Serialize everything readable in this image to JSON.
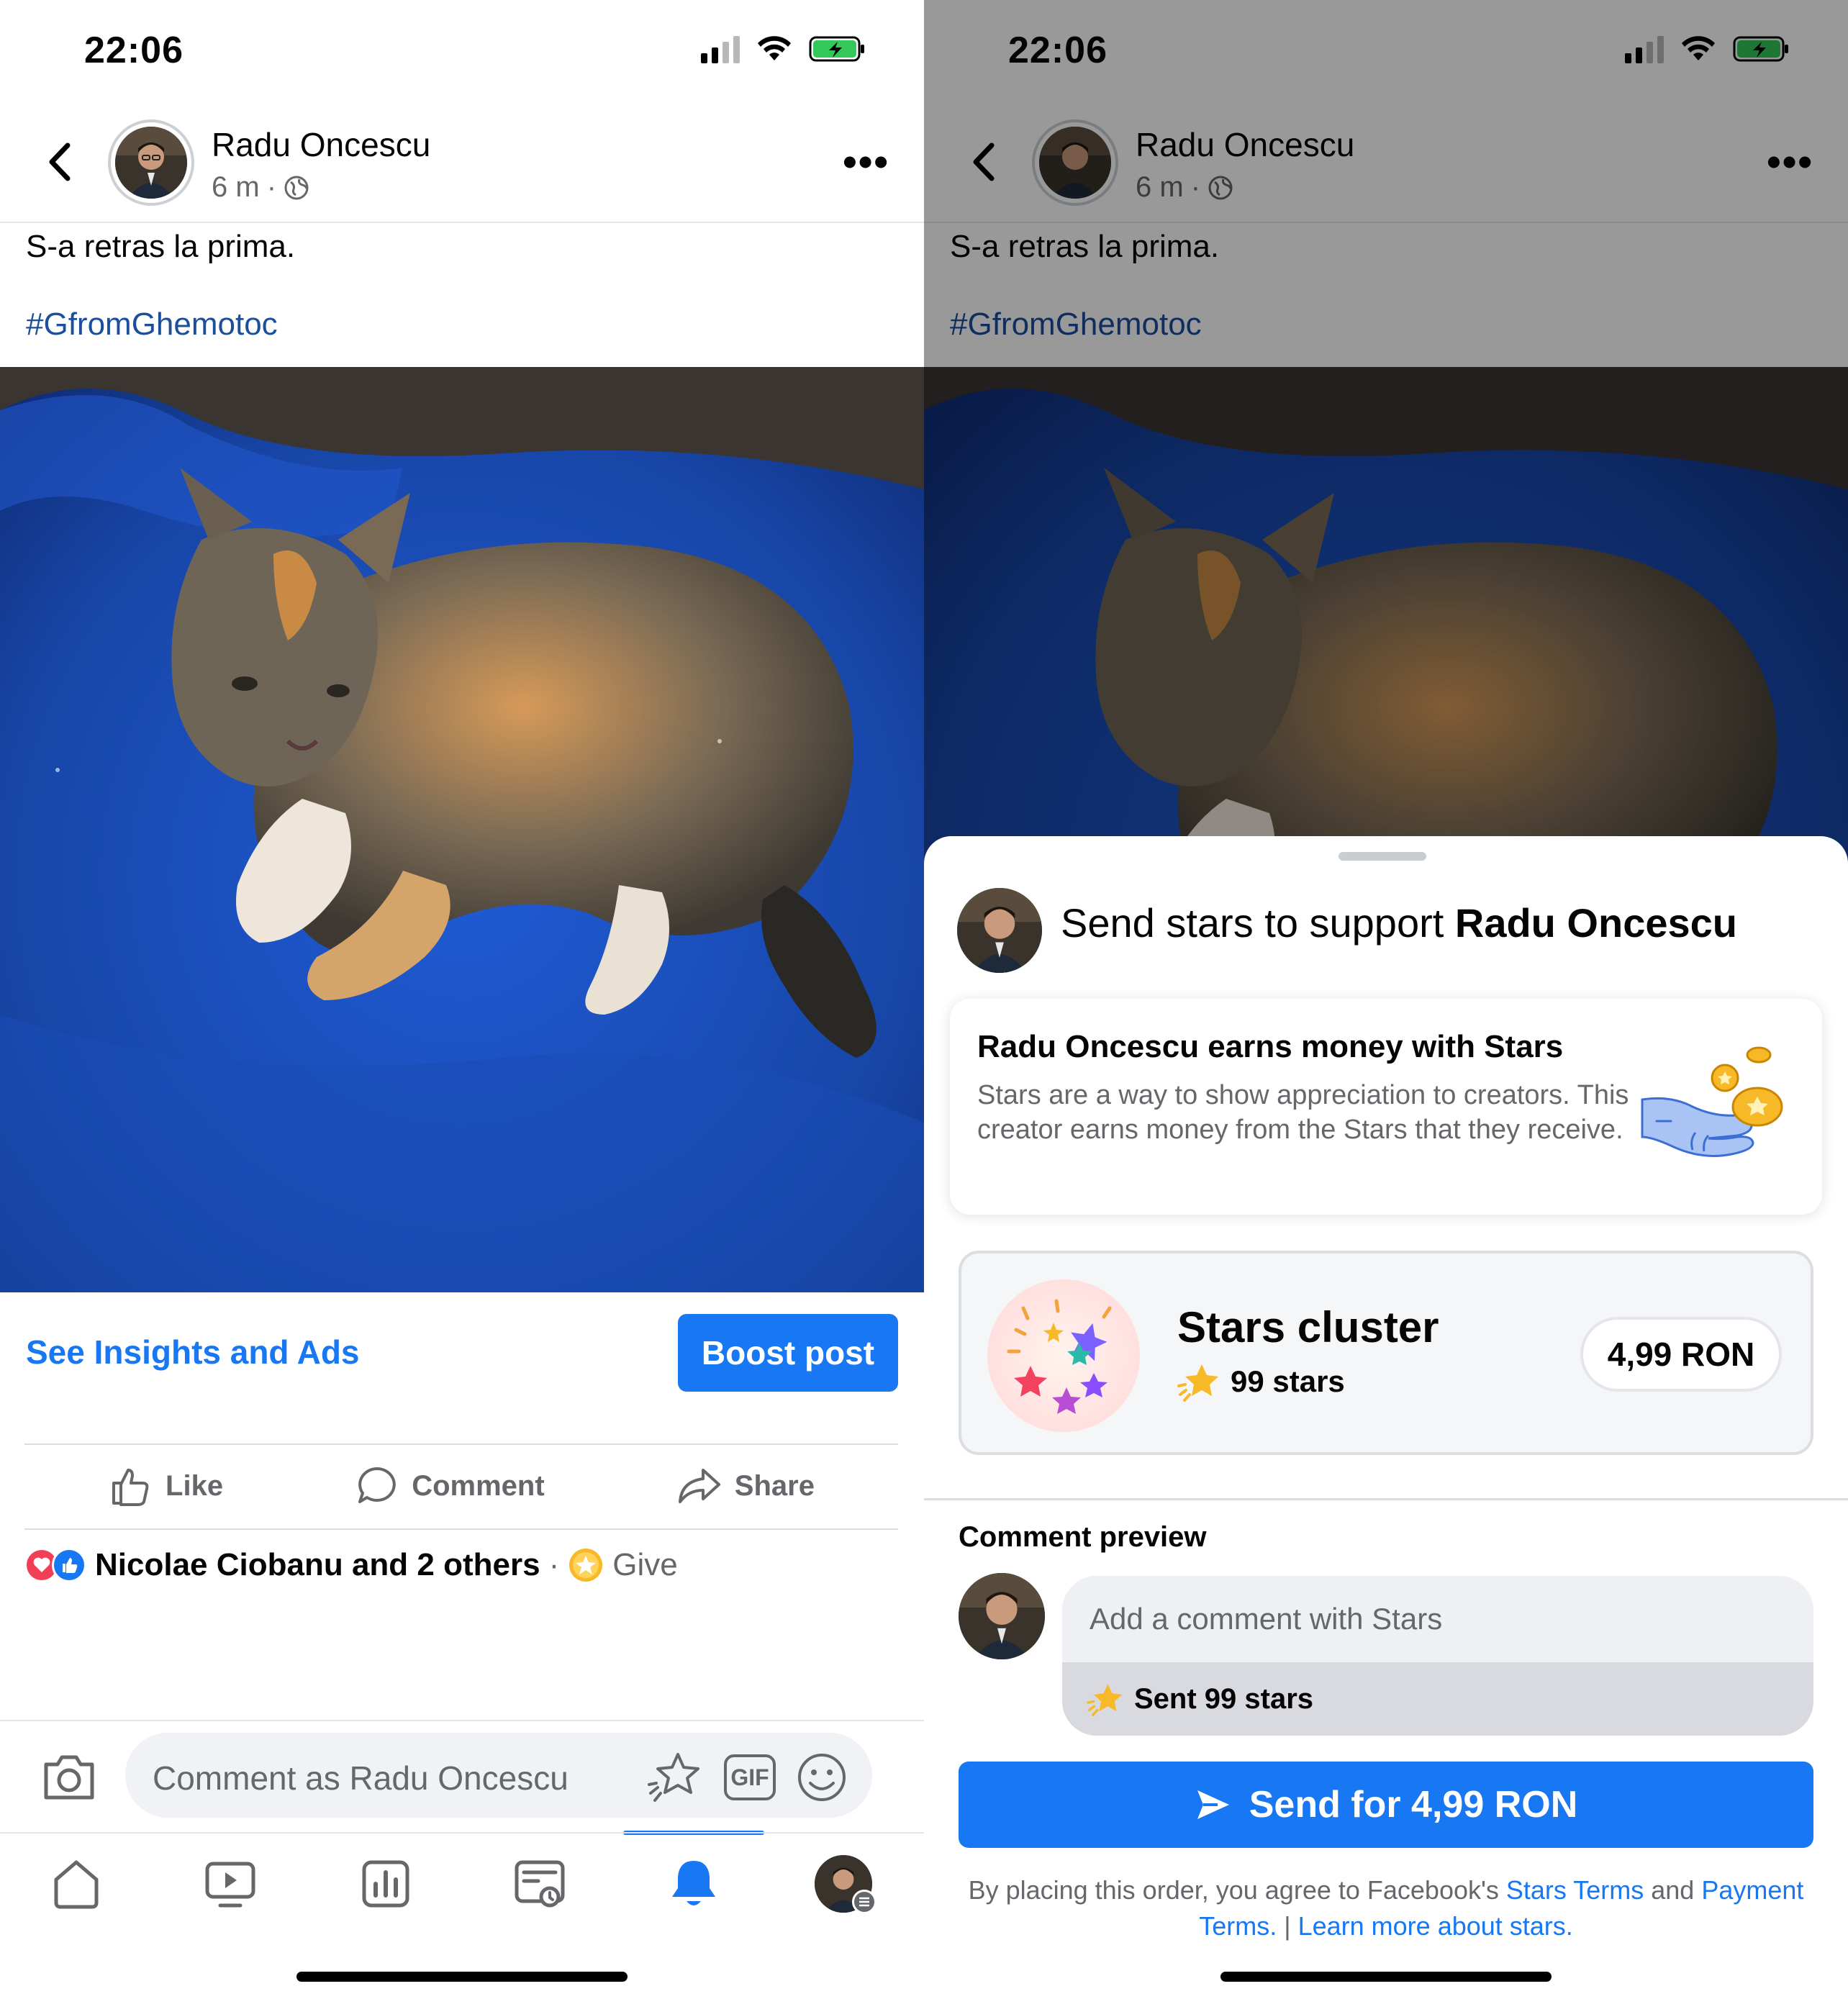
{
  "status": {
    "time": "22:06"
  },
  "post": {
    "author": "Radu Oncescu",
    "time": "6 m",
    "text": "S-a retras la prima.",
    "hashtag": "#GfromGhemotoc"
  },
  "promo": {
    "insights_label": "See Insights and Ads",
    "boost_label": "Boost post"
  },
  "actions": {
    "like": "Like",
    "comment": "Comment",
    "share": "Share"
  },
  "reactions": {
    "names": "Nicolae Ciobanu and 2 others",
    "separator": "·",
    "give": "Give"
  },
  "composer": {
    "placeholder": "Comment as Radu Oncescu",
    "gif": "GIF"
  },
  "tabs": [
    {
      "icon": "home-icon"
    },
    {
      "icon": "video-icon"
    },
    {
      "icon": "dashboard-icon"
    },
    {
      "icon": "feeds-icon"
    },
    {
      "icon": "bell-icon",
      "active": true
    },
    {
      "icon": "profile-avatar"
    }
  ],
  "sheet": {
    "title_prefix": "Send stars to support",
    "title_name": "Radu Oncescu",
    "earn_title": "Radu Oncescu earns money with Stars",
    "earn_body": "Stars are a way to show appreciation to creators. This creator earns money from the Stars that they receive.",
    "package_title": "Stars cluster",
    "package_count": "99 stars",
    "package_price": "4,99 RON",
    "comment_preview_label": "Comment preview",
    "comment_placeholder": "Add a comment with Stars",
    "sent_text": "Sent 99 stars",
    "send_button": "Send for 4,99 RON",
    "terms_prefix": "By placing this order, you agree to Facebook's",
    "terms_link1": "Stars Terms",
    "terms_and": "and",
    "terms_link2": "Payment Terms.",
    "terms_sep": "|",
    "terms_link3": "Learn more about stars."
  },
  "colors": {
    "accent": "#1877f2",
    "hashtag": "#1b4e9b",
    "muted": "#65676b"
  }
}
